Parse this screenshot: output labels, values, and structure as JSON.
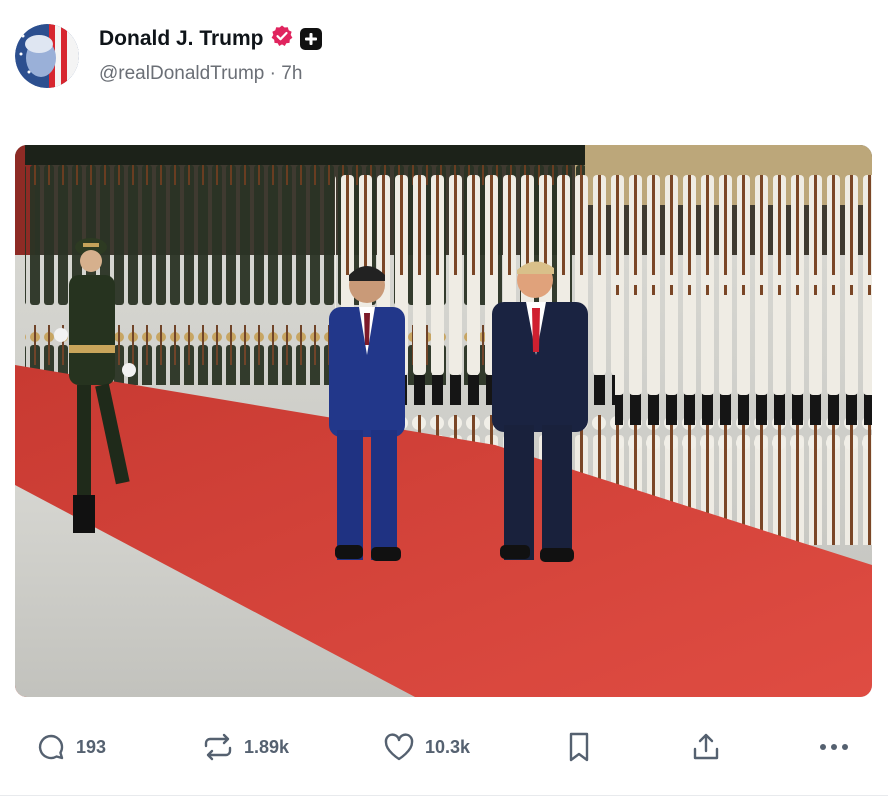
{
  "author": {
    "display_name": "Donald J. Trump",
    "handle": "@realDonaldTrump",
    "separator": "·",
    "time_ago": "7h",
    "verified_icon": "verified-badge-icon",
    "badge_icon": "plus-badge-icon"
  },
  "media": {
    "image_icon": "photo-guard-of-honor",
    "colors": {
      "carpet": "#d9473d",
      "pavement": "#c9c9c4",
      "uniform_dark": "#1f2a1d",
      "uniform_white": "#f1efe8"
    }
  },
  "actions": {
    "replies": "193",
    "reposts": "1.89k",
    "likes": "10.3k",
    "icons": [
      "reply-icon",
      "repost-icon",
      "like-icon",
      "bookmark-icon",
      "share-icon",
      "more-icon"
    ]
  },
  "colors": {
    "accent_verified": "#e0245e",
    "text_secondary": "#6b6f76",
    "action_gray": "#556170"
  }
}
